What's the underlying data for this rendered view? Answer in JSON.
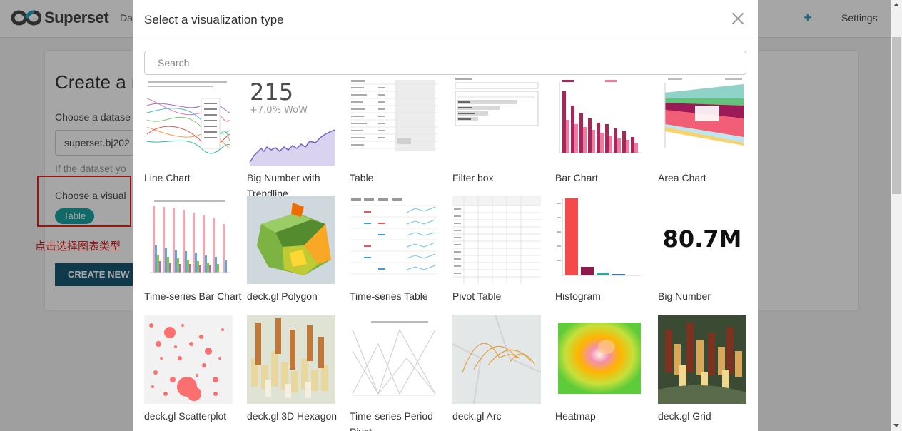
{
  "navbar": {
    "brand": "Superset",
    "menu_partial": "Da",
    "plus": "+",
    "settings_label": "Settings"
  },
  "background": {
    "title": "Create a n",
    "dataset_label": "Choose a datase",
    "dataset_value": "superset.bj202",
    "dataset_hint": "If the dataset yo",
    "viz_label": "Choose a visual",
    "viz_tag": "Table",
    "annotation": "点击选择图表类型",
    "create_button": "CREATE NEW CH"
  },
  "modal": {
    "title": "Select a visualization type",
    "search_placeholder": "Search",
    "big_number_text": "215",
    "big_number_sub": "+7.0% WoW",
    "big_number_2": "80.7M",
    "items": [
      {
        "label": "Line Chart",
        "icon": "line-chart-thumb"
      },
      {
        "label": "Big Number with Trendline",
        "icon": "big-number-trendline-thumb"
      },
      {
        "label": "Table",
        "icon": "table-thumb"
      },
      {
        "label": "Filter box",
        "icon": "filter-box-thumb"
      },
      {
        "label": "Bar Chart",
        "icon": "bar-chart-thumb"
      },
      {
        "label": "Area Chart",
        "icon": "area-chart-thumb"
      },
      {
        "label": "Time-series Bar Chart",
        "icon": "timeseries-bar-thumb"
      },
      {
        "label": "deck.gl Polygon",
        "icon": "deckgl-polygon-thumb"
      },
      {
        "label": "Time-series Table",
        "icon": "timeseries-table-thumb"
      },
      {
        "label": "Pivot Table",
        "icon": "pivot-table-thumb"
      },
      {
        "label": "Histogram",
        "icon": "histogram-thumb"
      },
      {
        "label": "Big Number",
        "icon": "big-number-thumb"
      },
      {
        "label": "deck.gl Scatterplot",
        "icon": "deckgl-scatterplot-thumb"
      },
      {
        "label": "deck.gl 3D Hexagon",
        "icon": "deckgl-3d-hexagon-thumb"
      },
      {
        "label": "Time-series Period Pivot",
        "icon": "timeseries-period-pivot-thumb"
      },
      {
        "label": "deck.gl Arc",
        "icon": "deckgl-arc-thumb"
      },
      {
        "label": "Heatmap",
        "icon": "heatmap-thumb"
      },
      {
        "label": "deck.gl Grid",
        "icon": "deckgl-grid-thumb"
      }
    ]
  },
  "colors": {
    "accent": "#20a7c9",
    "tag": "#1aa3a3",
    "annotation": "#e8221c",
    "create_button": "#1a5a73"
  }
}
